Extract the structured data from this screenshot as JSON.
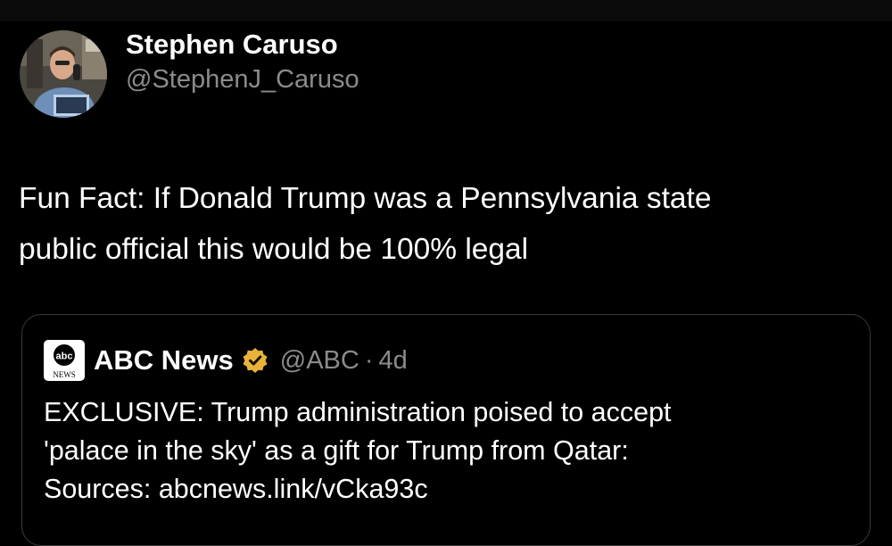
{
  "tweet": {
    "author": {
      "display_name": "Stephen Caruso",
      "handle": "@StephenJ_Caruso"
    },
    "text_line1": "Fun Fact: If Donald Trump was a Pennsylvania state",
    "text_line2": "public official this would be 100% legal"
  },
  "quoted_tweet": {
    "author": {
      "display_name": "ABC News",
      "handle": "@ABC",
      "verified_badge": "gold-verified-icon"
    },
    "separator": "·",
    "time_ago": "4d",
    "text_line1": "EXCLUSIVE: Trump administration poised to accept",
    "text_line2": "'palace in the sky' as a gift for Trump from Qatar:",
    "text_line3": "Sources: abcnews.link/vCka93c"
  },
  "colors": {
    "background": "#000000",
    "text_primary": "#ffffff",
    "text_secondary": "#8b8b8b",
    "card_border": "#3a3a3a",
    "verified_gold": "#e8b33a"
  }
}
